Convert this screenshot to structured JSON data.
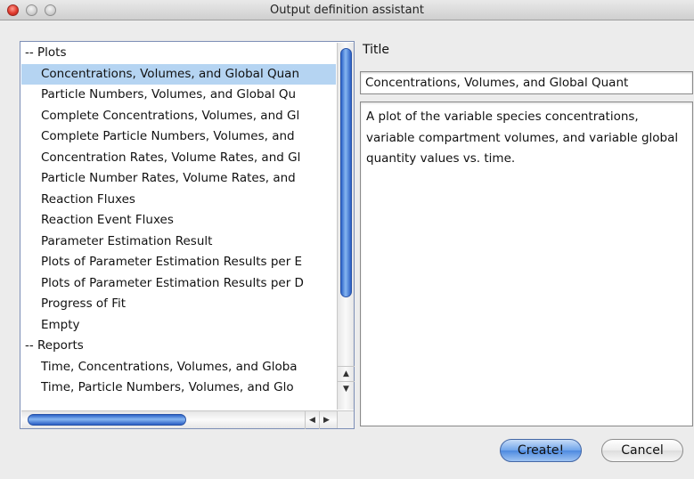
{
  "window": {
    "title": "Output definition assistant"
  },
  "list": {
    "rows": [
      {
        "label": "-- Plots",
        "kind": "header"
      },
      {
        "label": "Concentrations, Volumes, and Global Quan",
        "kind": "item",
        "selected": true
      },
      {
        "label": "Particle Numbers, Volumes, and Global Qu",
        "kind": "item"
      },
      {
        "label": "Complete Concentrations, Volumes, and Gl",
        "kind": "item"
      },
      {
        "label": "Complete Particle Numbers, Volumes, and",
        "kind": "item"
      },
      {
        "label": "Concentration Rates, Volume Rates, and Gl",
        "kind": "item"
      },
      {
        "label": "Particle Number Rates, Volume Rates, and",
        "kind": "item"
      },
      {
        "label": "Reaction Fluxes",
        "kind": "item"
      },
      {
        "label": "Reaction Event Fluxes",
        "kind": "item"
      },
      {
        "label": "Parameter Estimation Result",
        "kind": "item"
      },
      {
        "label": "Plots of Parameter Estimation Results per E",
        "kind": "item"
      },
      {
        "label": "Plots of Parameter Estimation Results per D",
        "kind": "item"
      },
      {
        "label": "Progress of Fit",
        "kind": "item"
      },
      {
        "label": "Empty",
        "kind": "item"
      },
      {
        "label": "-- Reports",
        "kind": "header"
      },
      {
        "label": "Time, Concentrations, Volumes, and Globa",
        "kind": "item"
      },
      {
        "label": "Time, Particle Numbers, Volumes, and Glo",
        "kind": "item"
      }
    ],
    "scroll_up_glyph": "▲",
    "scroll_down_glyph": "▼",
    "scroll_left_glyph": "◀",
    "scroll_right_glyph": "▶"
  },
  "detail": {
    "title_label": "Title",
    "title_value": "Concentrations, Volumes, and Global Quant",
    "description": "A plot of the variable species concentrations, variable compartment volumes, and variable global quantity values vs. time."
  },
  "buttons": {
    "create": "Create!",
    "cancel": "Cancel"
  },
  "colors": {
    "selection": "#b5d4f2",
    "accent": "#4e8ae0"
  }
}
